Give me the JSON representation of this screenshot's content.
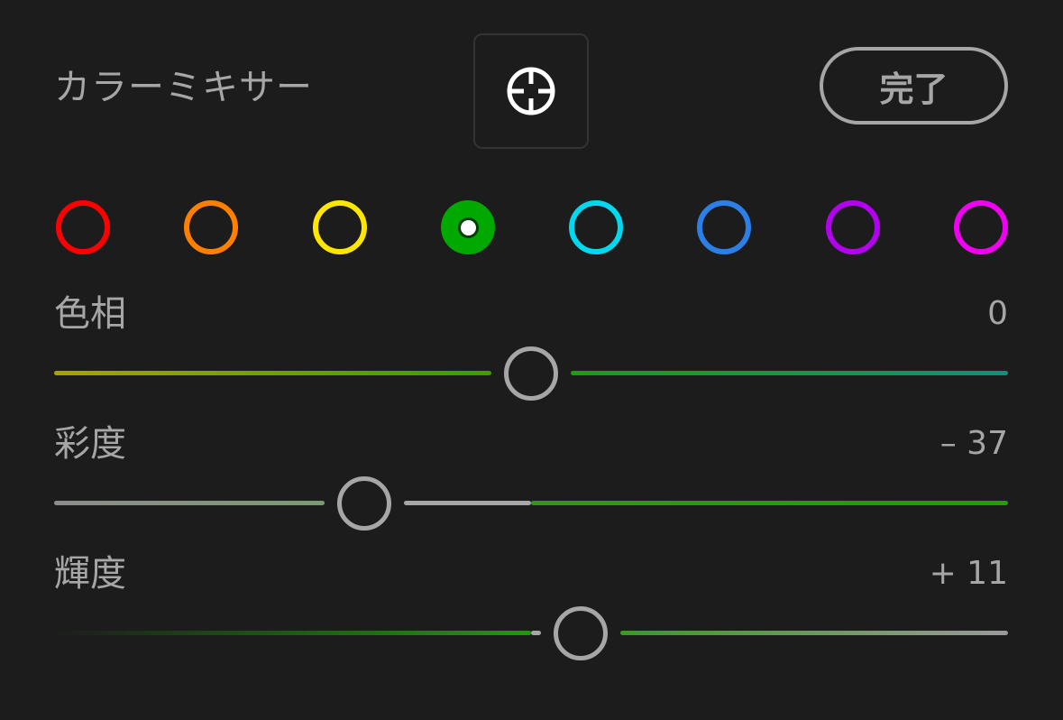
{
  "header": {
    "title": "カラーミキサー",
    "target_icon": "crosshair-icon",
    "done_label": "完了"
  },
  "swatches": [
    {
      "name": "red",
      "color": "#ff0000",
      "selected": false
    },
    {
      "name": "orange",
      "color": "#ff8000",
      "selected": false
    },
    {
      "name": "yellow",
      "color": "#ffe600",
      "selected": false
    },
    {
      "name": "green",
      "color": "#00a800",
      "selected": true
    },
    {
      "name": "aqua",
      "color": "#00d8f0",
      "selected": false
    },
    {
      "name": "blue",
      "color": "#2b7fe6",
      "selected": false
    },
    {
      "name": "purple",
      "color": "#b300f0",
      "selected": false
    },
    {
      "name": "magenta",
      "color": "#f000f0",
      "selected": false
    }
  ],
  "sliders": {
    "hue": {
      "label": "色相",
      "value_text": "0",
      "value": 0,
      "min": -100,
      "max": 100,
      "left_colors": [
        "#a8a300",
        "#36a000"
      ],
      "right_colors": [
        "#1d9d10",
        "#12907a"
      ]
    },
    "saturation": {
      "label": "彩度",
      "value_text": "– 37",
      "value": -37,
      "min": -100,
      "max": 100,
      "left_colors": [
        "#8c8c8c",
        "#7a9a70"
      ],
      "middle_color": "#a6a6a6",
      "right_colors": [
        "#2d9a18",
        "#1ea000"
      ]
    },
    "luminance": {
      "label": "輝度",
      "value_text": "+ 11",
      "value": 11,
      "min": -100,
      "max": 100,
      "left_colors": [
        "#1c1c1c",
        "#1f9a0c"
      ],
      "middle_color": "#a6a6a6",
      "right_colors": [
        "#3a9a20",
        "#9a9a9a"
      ]
    }
  },
  "theme": {
    "background": "#1c1c1c",
    "text": "#a6a6a6",
    "icon": "#ffffff"
  }
}
